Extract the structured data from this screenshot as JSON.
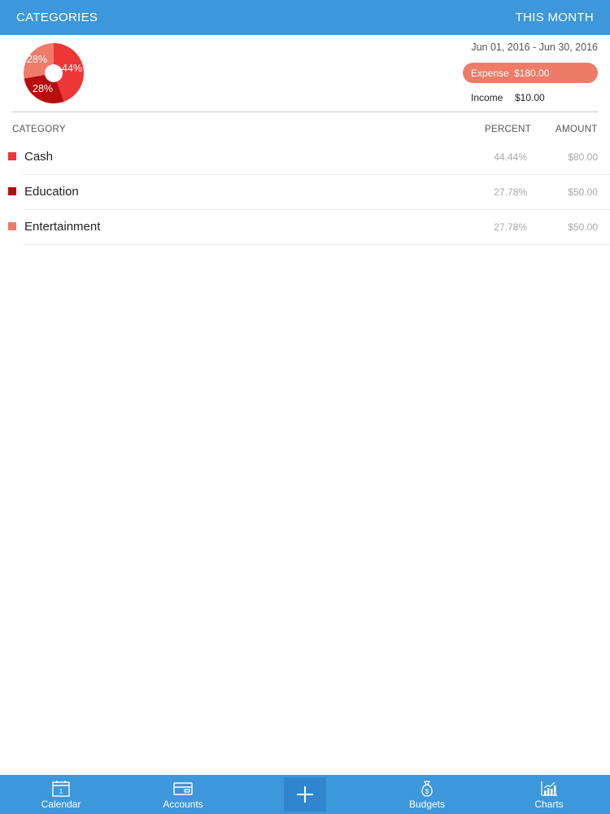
{
  "header": {
    "title": "CATEGORIES",
    "period": "THIS MONTH"
  },
  "summary": {
    "date_range": "Jun 01, 2016 - Jun 30, 2016",
    "expense_label": "Expense",
    "expense_value": "$180.00",
    "income_label": "Income",
    "income_value": "$10.00"
  },
  "pie": {
    "slices": [
      {
        "label": "44%",
        "value": 44.44,
        "color": "#ee3636"
      },
      {
        "label": "28%",
        "value": 27.78,
        "color": "#b80d0d"
      },
      {
        "label": "28%",
        "value": 27.78,
        "color": "#ef7b6b"
      }
    ]
  },
  "table": {
    "headers": {
      "category": "CATEGORY",
      "percent": "PERCENT",
      "amount": "AMOUNT"
    },
    "rows": [
      {
        "name": "Cash",
        "percent": "44.44%",
        "amount": "$80.00",
        "color": "#ee3636"
      },
      {
        "name": "Education",
        "percent": "27.78%",
        "amount": "$50.00",
        "color": "#b80d0d"
      },
      {
        "name": "Entertainment",
        "percent": "27.78%",
        "amount": "$50.00",
        "color": "#ef7b6b"
      }
    ]
  },
  "tabbar": {
    "items": [
      {
        "label": "Calendar",
        "icon": "calendar-icon",
        "icon_text": "1"
      },
      {
        "label": "Accounts",
        "icon": "card-icon"
      },
      {
        "label": "Budgets",
        "icon": "money-bag-icon"
      },
      {
        "label": "Charts",
        "icon": "chart-icon"
      }
    ],
    "add_icon": "plus-icon"
  }
}
